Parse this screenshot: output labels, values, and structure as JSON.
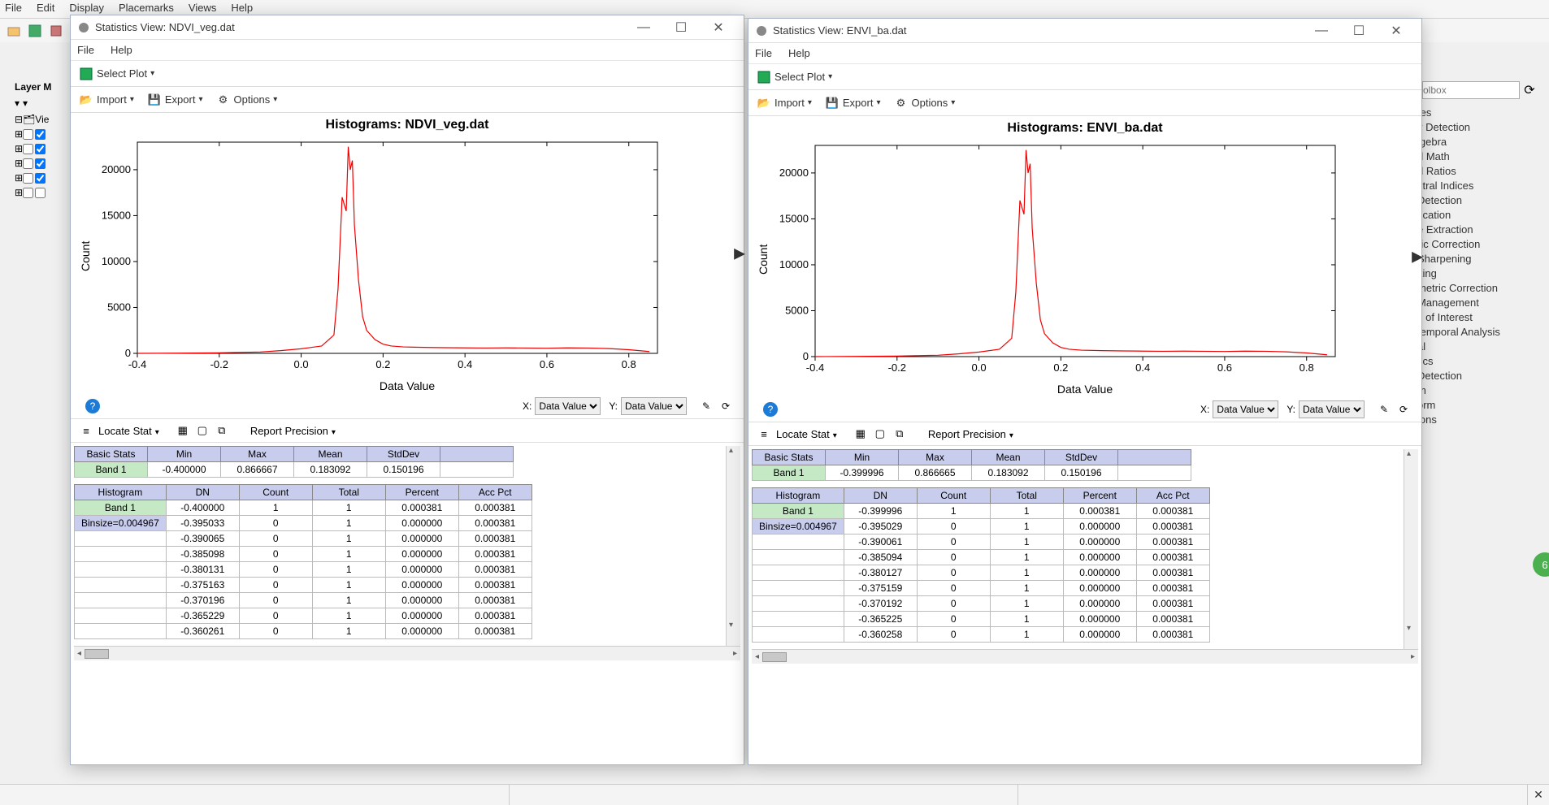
{
  "main_menu": [
    "File",
    "Edit",
    "Display",
    "Placemarks",
    "Views",
    "Help"
  ],
  "layer_label": "Layer M",
  "layer_root": "Vie",
  "toolbox_search_placeholder": "olbox",
  "toolbox_items": [
    "tes",
    "y Detection",
    "lgebra",
    "d Math",
    "d Ratios",
    "ctral Indices",
    " Detection",
    "fication",
    "e Extraction",
    "",
    "ric Correction",
    "Sharpening",
    "",
    "king",
    "",
    "metric Correction",
    "Management",
    "s of Interest",
    "temporal Analysis",
    "",
    "al",
    "tics",
    " Detection",
    "",
    "m",
    "orm",
    "",
    "ions"
  ],
  "win1": {
    "title": "Statistics View: NDVI_veg.dat",
    "menus": [
      "File",
      "Help"
    ],
    "select_plot": "Select Plot",
    "tools": {
      "import": "Import",
      "export": "Export",
      "options": "Options"
    },
    "chart_title": "Histograms: NDVI_veg.dat",
    "ylabel": "Count",
    "xlabel": "Data Value",
    "xsel_label": "X:",
    "ysel_label": "Y:",
    "xsel": "Data Value",
    "ysel": "Data Value",
    "locate": "Locate Stat",
    "report": "Report Precision",
    "basic_headers": [
      "Basic Stats",
      "Min",
      "Max",
      "Mean",
      "StdDev"
    ],
    "basic_row": [
      "Band 1",
      "-0.400000",
      "0.866667",
      "0.183092",
      "0.150196"
    ],
    "hist_headers": [
      "Histogram",
      "DN",
      "Count",
      "Total",
      "Percent",
      "Acc Pct"
    ],
    "hist_rows": [
      [
        "Band 1",
        "-0.400000",
        "1",
        "1",
        "0.000381",
        "0.000381"
      ],
      [
        "Binsize=0.004967",
        "-0.395033",
        "0",
        "1",
        "0.000000",
        "0.000381"
      ],
      [
        "",
        "-0.390065",
        "0",
        "1",
        "0.000000",
        "0.000381"
      ],
      [
        "",
        "-0.385098",
        "0",
        "1",
        "0.000000",
        "0.000381"
      ],
      [
        "",
        "-0.380131",
        "0",
        "1",
        "0.000000",
        "0.000381"
      ],
      [
        "",
        "-0.375163",
        "0",
        "1",
        "0.000000",
        "0.000381"
      ],
      [
        "",
        "-0.370196",
        "0",
        "1",
        "0.000000",
        "0.000381"
      ],
      [
        "",
        "-0.365229",
        "0",
        "1",
        "0.000000",
        "0.000381"
      ],
      [
        "",
        "-0.360261",
        "0",
        "1",
        "0.000000",
        "0.000381"
      ]
    ]
  },
  "win2": {
    "title": "Statistics View: ENVI_ba.dat",
    "menus": [
      "File",
      "Help"
    ],
    "select_plot": "Select Plot",
    "tools": {
      "import": "Import",
      "export": "Export",
      "options": "Options"
    },
    "chart_title": "Histograms: ENVI_ba.dat",
    "ylabel": "Count",
    "xlabel": "Data Value",
    "xsel_label": "X:",
    "ysel_label": "Y:",
    "xsel": "Data Value",
    "ysel": "Data Value",
    "locate": "Locate Stat",
    "report": "Report Precision",
    "basic_headers": [
      "Basic Stats",
      "Min",
      "Max",
      "Mean",
      "StdDev"
    ],
    "basic_row": [
      "Band 1",
      "-0.399996",
      "0.866665",
      "0.183092",
      "0.150196"
    ],
    "hist_headers": [
      "Histogram",
      "DN",
      "Count",
      "Total",
      "Percent",
      "Acc Pct"
    ],
    "hist_rows": [
      [
        "Band 1",
        "-0.399996",
        "1",
        "1",
        "0.000381",
        "0.000381"
      ],
      [
        "Binsize=0.004967",
        "-0.395029",
        "0",
        "1",
        "0.000000",
        "0.000381"
      ],
      [
        "",
        "-0.390061",
        "0",
        "1",
        "0.000000",
        "0.000381"
      ],
      [
        "",
        "-0.385094",
        "0",
        "1",
        "0.000000",
        "0.000381"
      ],
      [
        "",
        "-0.380127",
        "0",
        "1",
        "0.000000",
        "0.000381"
      ],
      [
        "",
        "-0.375159",
        "0",
        "1",
        "0.000000",
        "0.000381"
      ],
      [
        "",
        "-0.370192",
        "0",
        "1",
        "0.000000",
        "0.000381"
      ],
      [
        "",
        "-0.365225",
        "0",
        "1",
        "0.000000",
        "0.000381"
      ],
      [
        "",
        "-0.360258",
        "0",
        "1",
        "0.000000",
        "0.000381"
      ]
    ]
  },
  "chart_data": [
    {
      "type": "line",
      "title": "Histograms: NDVI_veg.dat",
      "xlabel": "Data Value",
      "ylabel": "Count",
      "xlim": [
        -0.4,
        0.87
      ],
      "ylim": [
        0,
        23000
      ],
      "xticks": [
        -0.4,
        -0.2,
        0.0,
        0.2,
        0.4,
        0.6,
        0.8
      ],
      "yticks": [
        0,
        5000,
        10000,
        15000,
        20000
      ],
      "x": [
        -0.4,
        -0.3,
        -0.2,
        -0.1,
        -0.05,
        0.0,
        0.05,
        0.08,
        0.09,
        0.1,
        0.11,
        0.115,
        0.12,
        0.125,
        0.13,
        0.14,
        0.15,
        0.16,
        0.18,
        0.2,
        0.22,
        0.25,
        0.3,
        0.35,
        0.4,
        0.45,
        0.5,
        0.55,
        0.6,
        0.65,
        0.7,
        0.75,
        0.8,
        0.85
      ],
      "y": [
        1,
        20,
        60,
        150,
        300,
        500,
        800,
        2000,
        7000,
        17000,
        15500,
        22500,
        20000,
        21000,
        14000,
        8000,
        4000,
        2500,
        1500,
        1000,
        800,
        700,
        650,
        620,
        600,
        580,
        600,
        580,
        560,
        600,
        580,
        520,
        400,
        200
      ]
    },
    {
      "type": "line",
      "title": "Histograms: ENVI_ba.dat",
      "xlabel": "Data Value",
      "ylabel": "Count",
      "xlim": [
        -0.4,
        0.87
      ],
      "ylim": [
        0,
        23000
      ],
      "xticks": [
        -0.4,
        -0.2,
        0.0,
        0.2,
        0.4,
        0.6,
        0.8
      ],
      "yticks": [
        0,
        5000,
        10000,
        15000,
        20000
      ],
      "x": [
        -0.4,
        -0.3,
        -0.2,
        -0.1,
        -0.05,
        0.0,
        0.05,
        0.08,
        0.09,
        0.1,
        0.11,
        0.115,
        0.12,
        0.125,
        0.13,
        0.14,
        0.15,
        0.16,
        0.18,
        0.2,
        0.22,
        0.25,
        0.3,
        0.35,
        0.4,
        0.45,
        0.5,
        0.55,
        0.6,
        0.65,
        0.7,
        0.75,
        0.8,
        0.85
      ],
      "y": [
        1,
        20,
        60,
        150,
        300,
        500,
        800,
        2000,
        7000,
        17000,
        15500,
        22500,
        20000,
        21000,
        14000,
        8000,
        4000,
        2500,
        1500,
        1000,
        800,
        700,
        650,
        620,
        600,
        580,
        600,
        580,
        560,
        600,
        580,
        520,
        400,
        200
      ]
    }
  ],
  "green_badge": "6"
}
